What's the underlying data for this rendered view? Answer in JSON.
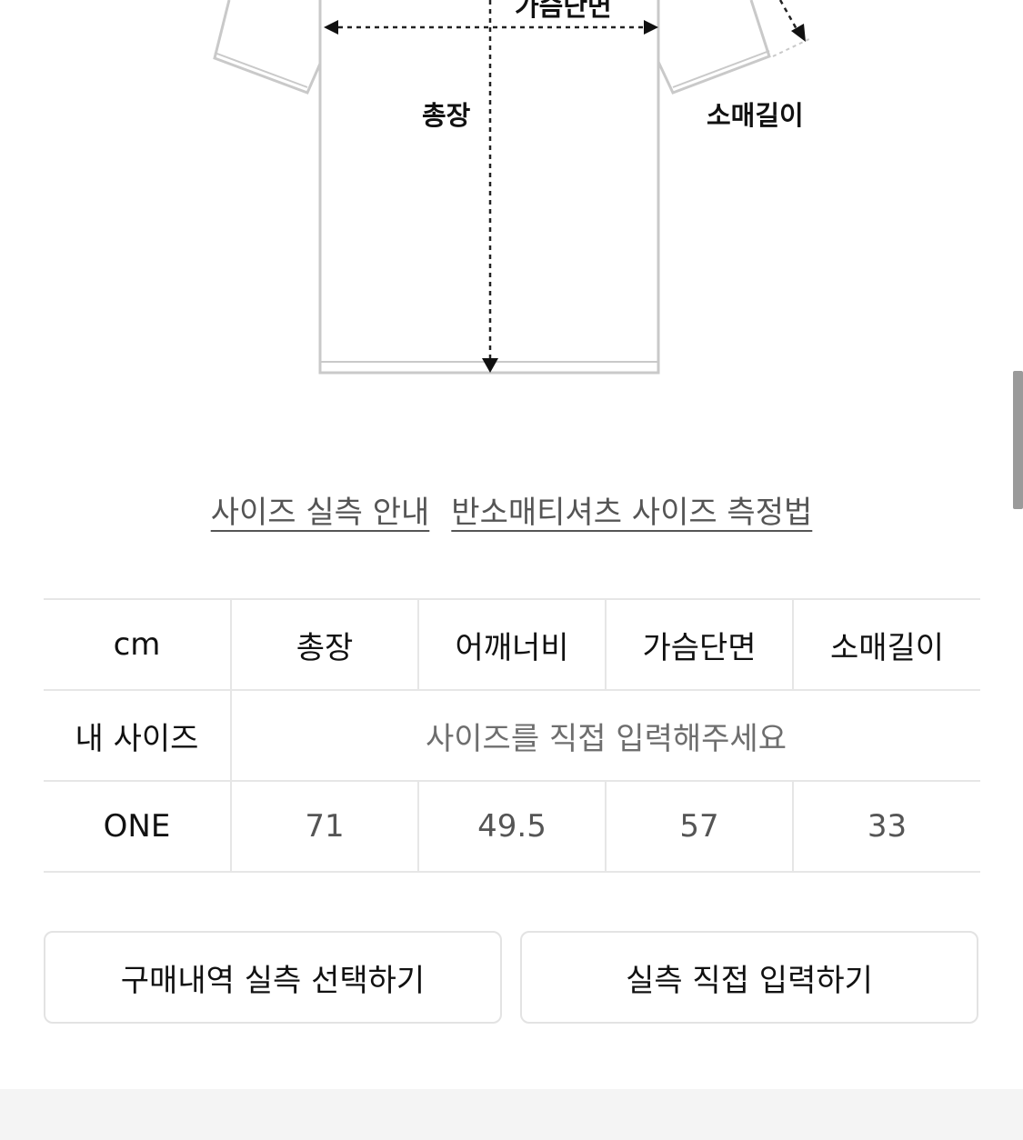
{
  "diagram": {
    "labels": {
      "chest": "가슴단면",
      "length": "총장",
      "sleeve": "소매길이"
    }
  },
  "links": {
    "size_guide": "사이즈 실측 안내",
    "measure_method": "반소매티셔츠 사이즈 측정법"
  },
  "table": {
    "headers": [
      "cm",
      "총장",
      "어깨너비",
      "가슴단면",
      "소매길이"
    ],
    "my_size_label": "내 사이즈",
    "my_size_placeholder": "사이즈를 직접 입력해주세요",
    "rows": [
      {
        "size": "ONE",
        "values": [
          "71",
          "49.5",
          "57",
          "33"
        ]
      }
    ]
  },
  "buttons": {
    "select_purchase": "구매내역 실측 선택하기",
    "direct_input": "실측 직접 입력하기"
  }
}
